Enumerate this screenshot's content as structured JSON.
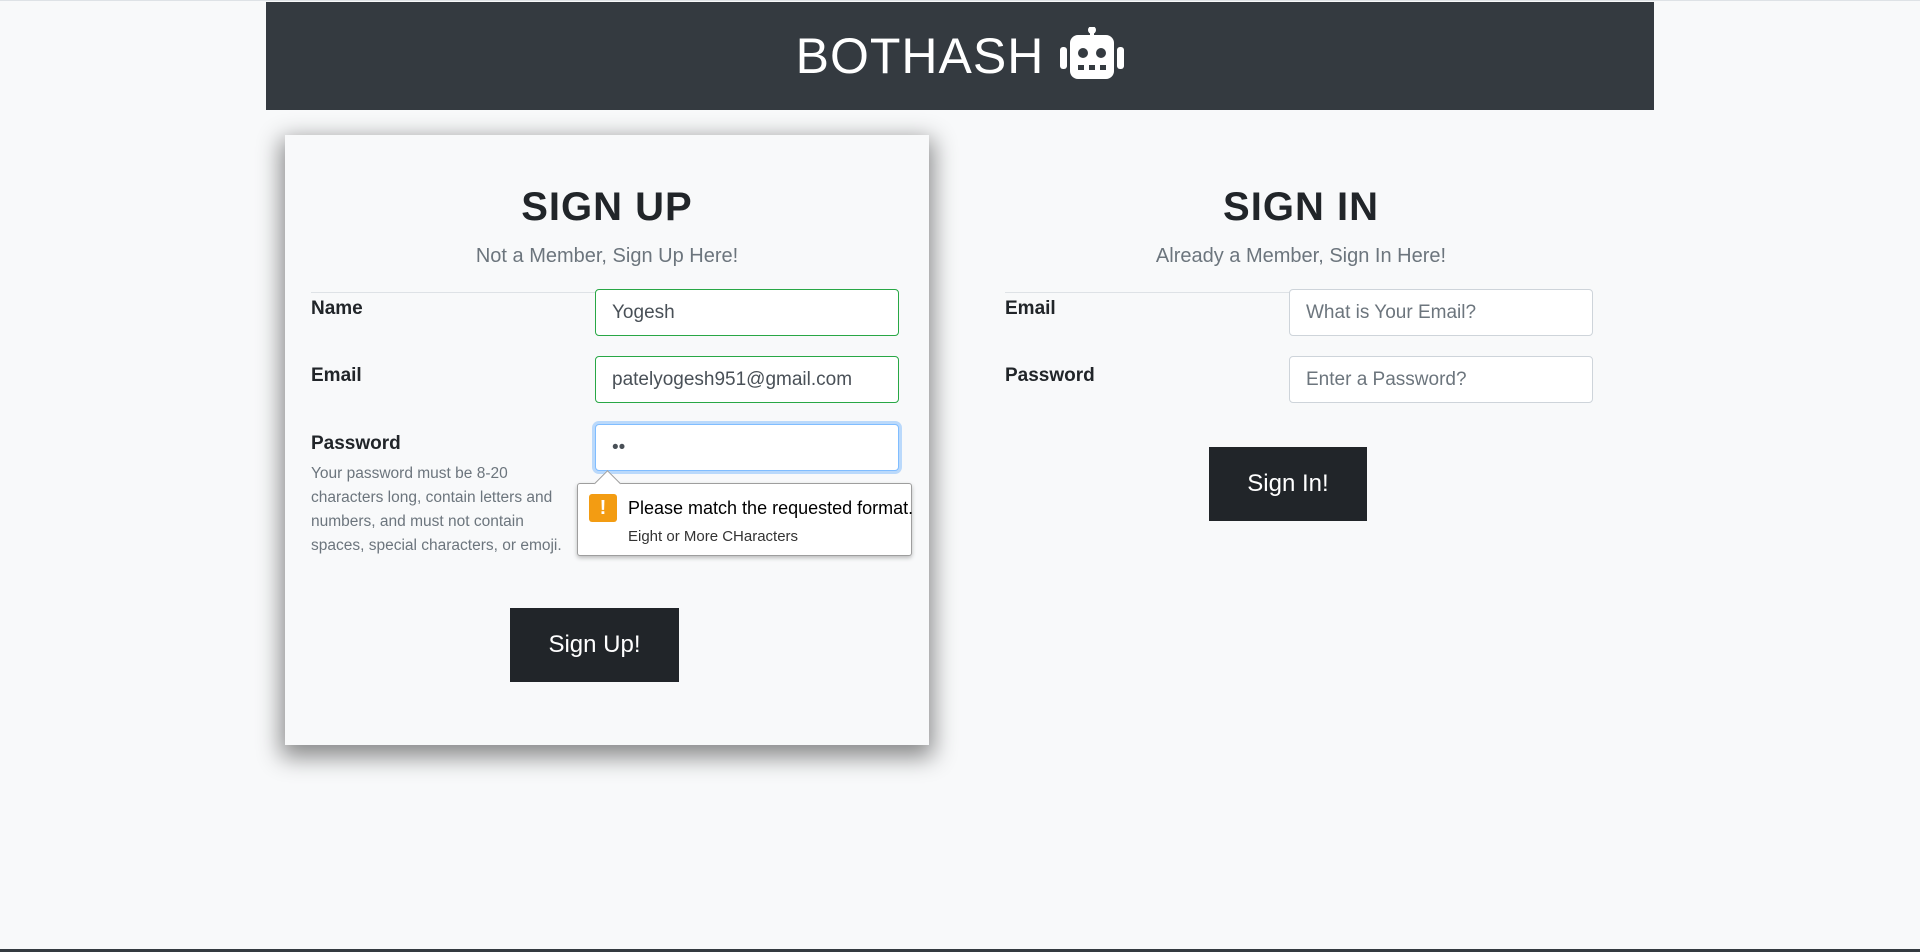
{
  "header": {
    "brand": "BOTHASH",
    "icon": "robot-icon"
  },
  "signup": {
    "title": "SIGN UP",
    "subtitle": "Not a Member, Sign Up Here!",
    "name_label": "Name",
    "name_value": "Yogesh",
    "email_label": "Email",
    "email_value": "patelyogesh951@gmail.com",
    "password_label": "Password",
    "password_value": "••",
    "password_help": "Your password must be 8-20 characters long, contain letters and numbers, and must not contain spaces, special characters, or emoji.",
    "button": "Sign Up!"
  },
  "validation_tooltip": {
    "icon": "warning-icon",
    "message": "Please match the requested format.",
    "detail": "Eight or More CHaracters"
  },
  "signin": {
    "title": "SIGN IN",
    "subtitle": "Already a Member, Sign In Here!",
    "email_label": "Email",
    "email_placeholder": "What is Your Email?",
    "password_label": "Password",
    "password_placeholder": "Enter a Password?",
    "button": "Sign In!"
  },
  "colors": {
    "header_bg": "#343a40",
    "button_bg": "#212529",
    "valid_border": "#28a745",
    "focus_border": "#80bdff",
    "warning": "#f39c12"
  }
}
